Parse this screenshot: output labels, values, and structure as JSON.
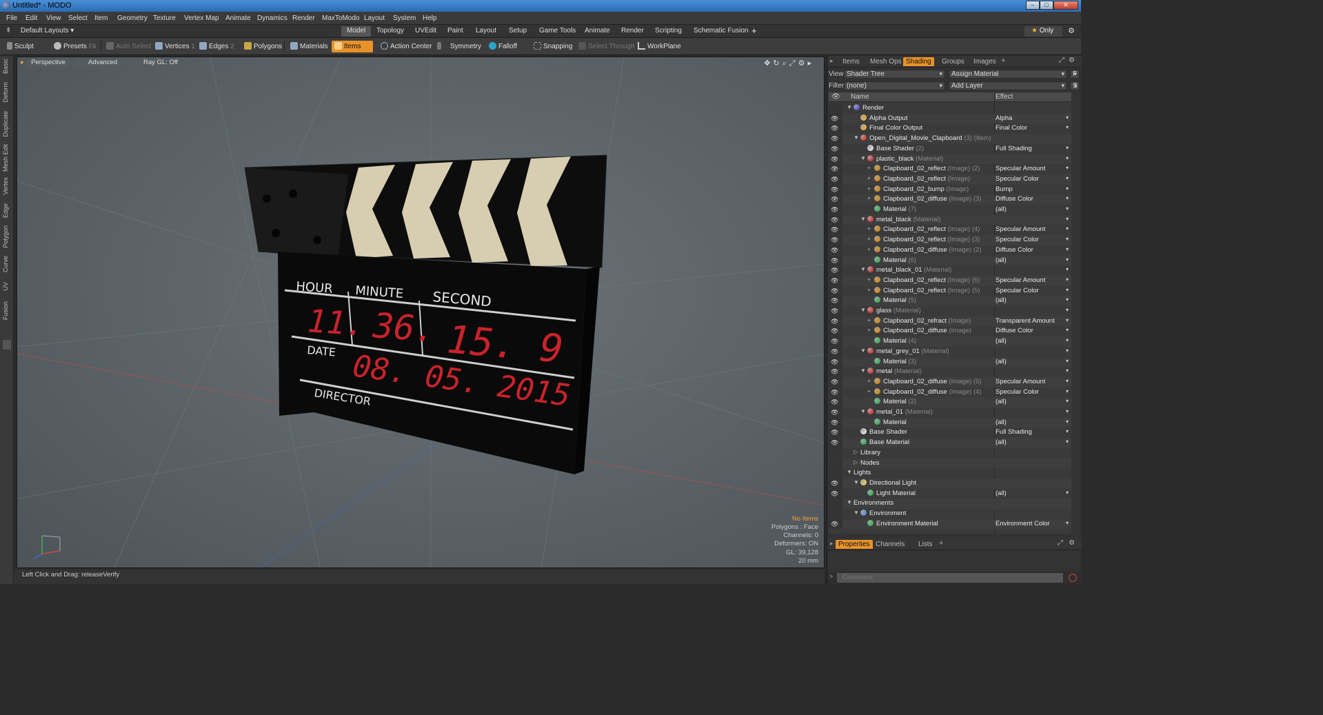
{
  "window": {
    "title": "Untitled* - MODO"
  },
  "menu": [
    "File",
    "Edit",
    "View",
    "Select",
    "Item",
    "Geometry",
    "Texture",
    "Vertex Map",
    "Animate",
    "Dynamics",
    "Render",
    "MaxToModo",
    "Layout",
    "System",
    "Help"
  ],
  "layout": {
    "selector": "Default Layouts ▾",
    "tabs": [
      "Model",
      "Topology",
      "UVEdit",
      "Paint",
      "Layout",
      "Setup",
      "Game Tools",
      "Animate",
      "Render",
      "Scripting",
      "Schematic Fusion"
    ],
    "active_tab": "Model",
    "only_label": "Only"
  },
  "toolbar": {
    "sculpt": "Sculpt",
    "presets": "Presets",
    "presets_key": "F6",
    "auto_select": "Auto Select",
    "vertices": "Vertices",
    "vertices_key": "1",
    "edges": "Edges",
    "edges_key": "2",
    "polygons": "Polygons",
    "materials": "Materials",
    "items": "Items",
    "action_center": "Action Center",
    "symmetry": "Symmetry",
    "falloff": "Falloff",
    "snapping": "Snapping",
    "select_through": "Select Through",
    "workplane": "WorkPlane"
  },
  "left_tabs": [
    "Basic",
    "Deform",
    "Duplicate",
    "Mesh Edit",
    "Vertex",
    "Edge",
    "Polygon",
    "Curve",
    "UV",
    "Fusion"
  ],
  "viewport": {
    "perspective": "Perspective",
    "advanced": "Advanced",
    "raygl": "Ray GL: Off",
    "clapper": {
      "hour_label": "HOUR",
      "minute_label": "MINUTE",
      "second_label": "SECOND",
      "hour": "11.",
      "minute": "36.",
      "second": "15. 9",
      "date_label": "DATE",
      "date": "08. 05. 2015",
      "director_label": "DIRECTOR"
    },
    "info": {
      "no_items": "No Items",
      "polygons": "Polygons : Face",
      "channels": "Channels: 0",
      "deformers": "Deformers: ON",
      "gl": "GL: 39,128",
      "scale": "20 mm"
    }
  },
  "status": {
    "hint": "Left Click and Drag:   releaseVerify"
  },
  "panel": {
    "tabs": [
      "Items",
      "Mesh Ops",
      "Shading",
      "Groups",
      "Images"
    ],
    "active_tab": "Shading",
    "view_label": "View",
    "view_value": "Shader Tree",
    "assign_material": "Assign Material",
    "f_btn": "F",
    "filter_label": "Filter",
    "filter_value": "(none)",
    "add_layer": "Add Layer",
    "s_btn": "S",
    "col_name": "Name",
    "col_effect": "Effect",
    "tree": [
      {
        "d": 0,
        "name": "Render",
        "sub": "",
        "effect": "",
        "icon": "#5a5ad0",
        "eye": false,
        "tri": "▼"
      },
      {
        "d": 1,
        "name": "Alpha Output",
        "sub": "",
        "effect": "Alpha",
        "icon": "#e0b040",
        "eye": true,
        "tri": ""
      },
      {
        "d": 1,
        "name": "Final Color Output",
        "sub": "",
        "effect": "Final Color",
        "icon": "#e0b040",
        "eye": true,
        "tri": ""
      },
      {
        "d": 1,
        "name": "Open_Digital_Movie_Clapboard",
        "sub": " (3) (Item)",
        "effect": "",
        "icon": "#d04040",
        "eye": true,
        "tri": "▼"
      },
      {
        "d": 2,
        "name": "Base Shader",
        "sub": " (2)",
        "effect": "Full Shading",
        "icon": "#dddddd",
        "eye": true,
        "tri": ""
      },
      {
        "d": 2,
        "name": "plastic_black",
        "sub": " (Material)",
        "effect": "",
        "icon": "#d04040",
        "eye": true,
        "tri": "▼"
      },
      {
        "d": 3,
        "name": "Clapboard_02_reflect",
        "sub": " (Image) (2)",
        "effect": "Specular Amount",
        "icon": "#d08a20",
        "eye": true,
        "tri": "+"
      },
      {
        "d": 3,
        "name": "Clapboard_02_reflect",
        "sub": " (Image)",
        "effect": "Specular Color",
        "icon": "#d08a20",
        "eye": true,
        "tri": "+"
      },
      {
        "d": 3,
        "name": "Clapboard_02_bump",
        "sub": " (Image)",
        "effect": "Bump",
        "icon": "#d08a20",
        "eye": true,
        "tri": "+"
      },
      {
        "d": 3,
        "name": "Clapboard_02_diffuse",
        "sub": " (Image) (3)",
        "effect": "Diffuse Color",
        "icon": "#d08a20",
        "eye": true,
        "tri": "+"
      },
      {
        "d": 3,
        "name": "Material",
        "sub": " (7)",
        "effect": "(all)",
        "icon": "#40b060",
        "eye": true,
        "tri": ""
      },
      {
        "d": 2,
        "name": "metal_black",
        "sub": " (Material)",
        "effect": "",
        "icon": "#d04040",
        "eye": true,
        "tri": "▼"
      },
      {
        "d": 3,
        "name": "Clapboard_02_reflect",
        "sub": " (Image) (4)",
        "effect": "Specular Amount",
        "icon": "#d08a20",
        "eye": true,
        "tri": "+"
      },
      {
        "d": 3,
        "name": "Clapboard_02_reflect",
        "sub": " (Image) (3)",
        "effect": "Specular Color",
        "icon": "#d08a20",
        "eye": true,
        "tri": "+"
      },
      {
        "d": 3,
        "name": "Clapboard_02_diffuse",
        "sub": " (Image) (2)",
        "effect": "Diffuse Color",
        "icon": "#d08a20",
        "eye": true,
        "tri": "+"
      },
      {
        "d": 3,
        "name": "Material",
        "sub": " (6)",
        "effect": "(all)",
        "icon": "#40b060",
        "eye": true,
        "tri": ""
      },
      {
        "d": 2,
        "name": "metal_black_01",
        "sub": " (Material)",
        "effect": "",
        "icon": "#d04040",
        "eye": true,
        "tri": "▼"
      },
      {
        "d": 3,
        "name": "Clapboard_02_reflect",
        "sub": " (Image) (6)",
        "effect": "Specular Amount",
        "icon": "#d08a20",
        "eye": true,
        "tri": "+"
      },
      {
        "d": 3,
        "name": "Clapboard_02_reflect",
        "sub": " (Image) (5)",
        "effect": "Specular Color",
        "icon": "#d08a20",
        "eye": true,
        "tri": "+"
      },
      {
        "d": 3,
        "name": "Material",
        "sub": " (5)",
        "effect": "(all)",
        "icon": "#40b060",
        "eye": true,
        "tri": ""
      },
      {
        "d": 2,
        "name": "glass",
        "sub": " (Material)",
        "effect": "",
        "icon": "#d04040",
        "eye": true,
        "tri": "▼"
      },
      {
        "d": 3,
        "name": "Clapboard_02_refract",
        "sub": " (Image)",
        "effect": "Transparent Amount",
        "icon": "#d08a20",
        "eye": true,
        "tri": "+"
      },
      {
        "d": 3,
        "name": "Clapboard_02_diffuse",
        "sub": " (Image)",
        "effect": "Diffuse Color",
        "icon": "#d08a20",
        "eye": true,
        "tri": "+"
      },
      {
        "d": 3,
        "name": "Material",
        "sub": " (4)",
        "effect": "(all)",
        "icon": "#40b060",
        "eye": true,
        "tri": ""
      },
      {
        "d": 2,
        "name": "metal_grey_01",
        "sub": " (Material)",
        "effect": "",
        "icon": "#d04040",
        "eye": true,
        "tri": "▼"
      },
      {
        "d": 3,
        "name": "Material",
        "sub": " (3)",
        "effect": "(all)",
        "icon": "#40b060",
        "eye": true,
        "tri": ""
      },
      {
        "d": 2,
        "name": "metal",
        "sub": " (Material)",
        "effect": "",
        "icon": "#d04040",
        "eye": true,
        "tri": "▼"
      },
      {
        "d": 3,
        "name": "Clapboard_02_diffuse",
        "sub": " (Image) (5)",
        "effect": "Specular Amount",
        "icon": "#d08a20",
        "eye": true,
        "tri": "+"
      },
      {
        "d": 3,
        "name": "Clapboard_02_diffuse",
        "sub": " (Image) (4)",
        "effect": "Specular Color",
        "icon": "#d08a20",
        "eye": true,
        "tri": "+"
      },
      {
        "d": 3,
        "name": "Material",
        "sub": " (2)",
        "effect": "(all)",
        "icon": "#40b060",
        "eye": true,
        "tri": ""
      },
      {
        "d": 2,
        "name": "metal_01",
        "sub": " (Material)",
        "effect": "",
        "icon": "#d04040",
        "eye": true,
        "tri": "▼"
      },
      {
        "d": 3,
        "name": "Material",
        "sub": "",
        "effect": "(all)",
        "icon": "#40b060",
        "eye": true,
        "tri": ""
      },
      {
        "d": 1,
        "name": "Base Shader",
        "sub": "",
        "effect": "Full Shading",
        "icon": "#dddddd",
        "eye": true,
        "tri": ""
      },
      {
        "d": 1,
        "name": "Base Material",
        "sub": "",
        "effect": "(all)",
        "icon": "#40b060",
        "eye": true,
        "tri": ""
      },
      {
        "d": 1,
        "name": "Library",
        "sub": "",
        "effect": "",
        "icon": "",
        "eye": false,
        "tri": "▷"
      },
      {
        "d": 1,
        "name": "Nodes",
        "sub": "",
        "effect": "",
        "icon": "",
        "eye": false,
        "tri": "▷"
      },
      {
        "d": 0,
        "name": "Lights",
        "sub": "",
        "effect": "",
        "icon": "",
        "eye": false,
        "tri": "▼"
      },
      {
        "d": 1,
        "name": "Directional Light",
        "sub": "",
        "effect": "",
        "icon": "#e0d060",
        "eye": true,
        "tri": "▼"
      },
      {
        "d": 2,
        "name": "Light Material",
        "sub": "",
        "effect": "(all)",
        "icon": "#40b060",
        "eye": true,
        "tri": ""
      },
      {
        "d": 0,
        "name": "Environments",
        "sub": "",
        "effect": "",
        "icon": "",
        "eye": false,
        "tri": "▼"
      },
      {
        "d": 1,
        "name": "Environment",
        "sub": "",
        "effect": "",
        "icon": "#6090e0",
        "eye": false,
        "tri": "▼"
      },
      {
        "d": 2,
        "name": "Environment Material",
        "sub": "",
        "effect": "Environment Color",
        "icon": "#40b060",
        "eye": true,
        "tri": ""
      }
    ],
    "bottom_tabs": [
      "Properties",
      "Channels",
      "Lists"
    ],
    "bottom_active": "Properties",
    "command_placeholder": "Command"
  }
}
